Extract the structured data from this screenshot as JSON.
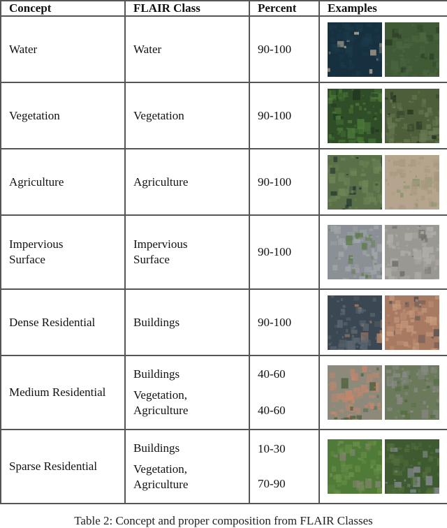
{
  "table": {
    "headers": [
      "Concept",
      "FLAIR Class",
      "Percent",
      "Examples"
    ],
    "rows": [
      {
        "concept": "Water",
        "classes": [
          "Water"
        ],
        "percents": [
          "90-100"
        ],
        "examples": [
          {
            "name": "water-example-1",
            "colors": [
              "#17303f",
              "#1c3a4a",
              "#b9ab93"
            ]
          },
          {
            "name": "water-example-2",
            "colors": [
              "#3f5a35",
              "#4a6640",
              "#2d3f28"
            ]
          }
        ]
      },
      {
        "concept": "Vegetation",
        "classes": [
          "Vegetation"
        ],
        "percents": [
          "90-100"
        ],
        "examples": [
          {
            "name": "vegetation-example-1",
            "colors": [
              "#2f4d27",
              "#4c7a3a",
              "#1f3320"
            ]
          },
          {
            "name": "vegetation-example-2",
            "colors": [
              "#4d5e3a",
              "#6b7a55",
              "#22301d"
            ]
          }
        ]
      },
      {
        "concept": "Agriculture",
        "classes": [
          "Agriculture"
        ],
        "percents": [
          "90-100"
        ],
        "examples": [
          {
            "name": "agriculture-example-1",
            "colors": [
              "#5a7048",
              "#6f8557",
              "#1d2f2c"
            ]
          },
          {
            "name": "agriculture-example-2",
            "colors": [
              "#b5a58e",
              "#a89880",
              "#7e9363"
            ]
          }
        ]
      },
      {
        "concept": "Impervious\nSurface",
        "concept_lines": [
          "Impervious",
          "Surface"
        ],
        "classes": [
          "Impervious\nSurface"
        ],
        "class_lines": [
          "Impervious",
          "Surface"
        ],
        "percents": [
          "90-100"
        ],
        "examples": [
          {
            "name": "impervious-example-1",
            "colors": [
              "#8a9095",
              "#a3a8ab",
              "#5d7a4a"
            ]
          },
          {
            "name": "impervious-example-2",
            "colors": [
              "#9a9893",
              "#b0aea8",
              "#6f6d69"
            ]
          }
        ]
      },
      {
        "concept": "Dense Residential",
        "classes": [
          "Buildings"
        ],
        "percents": [
          "90-100"
        ],
        "examples": [
          {
            "name": "dense-residential-example-1",
            "colors": [
              "#3b4853",
              "#5b6670",
              "#c08a6a"
            ]
          },
          {
            "name": "dense-residential-example-2",
            "colors": [
              "#a87a62",
              "#c79a7c",
              "#4a4e52"
            ]
          }
        ]
      },
      {
        "concept": "Medium Residential",
        "classes": [
          "Buildings",
          "Vegetation,\nAgriculture"
        ],
        "class_lines": [
          [
            "Buildings"
          ],
          [
            "Vegetation,",
            "Agriculture"
          ]
        ],
        "percents": [
          "40-60",
          "40-60"
        ],
        "examples": [
          {
            "name": "medium-residential-example-1",
            "colors": [
              "#8d8a7c",
              "#c8866a",
              "#4d6240"
            ]
          },
          {
            "name": "medium-residential-example-2",
            "colors": [
              "#6c7a5c",
              "#8a8a86",
              "#4f6b3c"
            ]
          }
        ]
      },
      {
        "concept": "Sparse Residential",
        "classes": [
          "Buildings",
          "Vegetation,\nAgriculture"
        ],
        "class_lines": [
          [
            "Buildings"
          ],
          [
            "Vegetation,",
            "Agriculture"
          ]
        ],
        "percents": [
          "10-30",
          "70-90"
        ],
        "examples": [
          {
            "name": "sparse-residential-example-1",
            "colors": [
              "#4f7a38",
              "#6a9048",
              "#8a8578"
            ]
          },
          {
            "name": "sparse-residential-example-2",
            "colors": [
              "#3e5a30",
              "#54703e",
              "#8a8e96"
            ]
          }
        ]
      }
    ]
  },
  "caption": "Table 2: Concept and proper composition from FLAIR Classes"
}
